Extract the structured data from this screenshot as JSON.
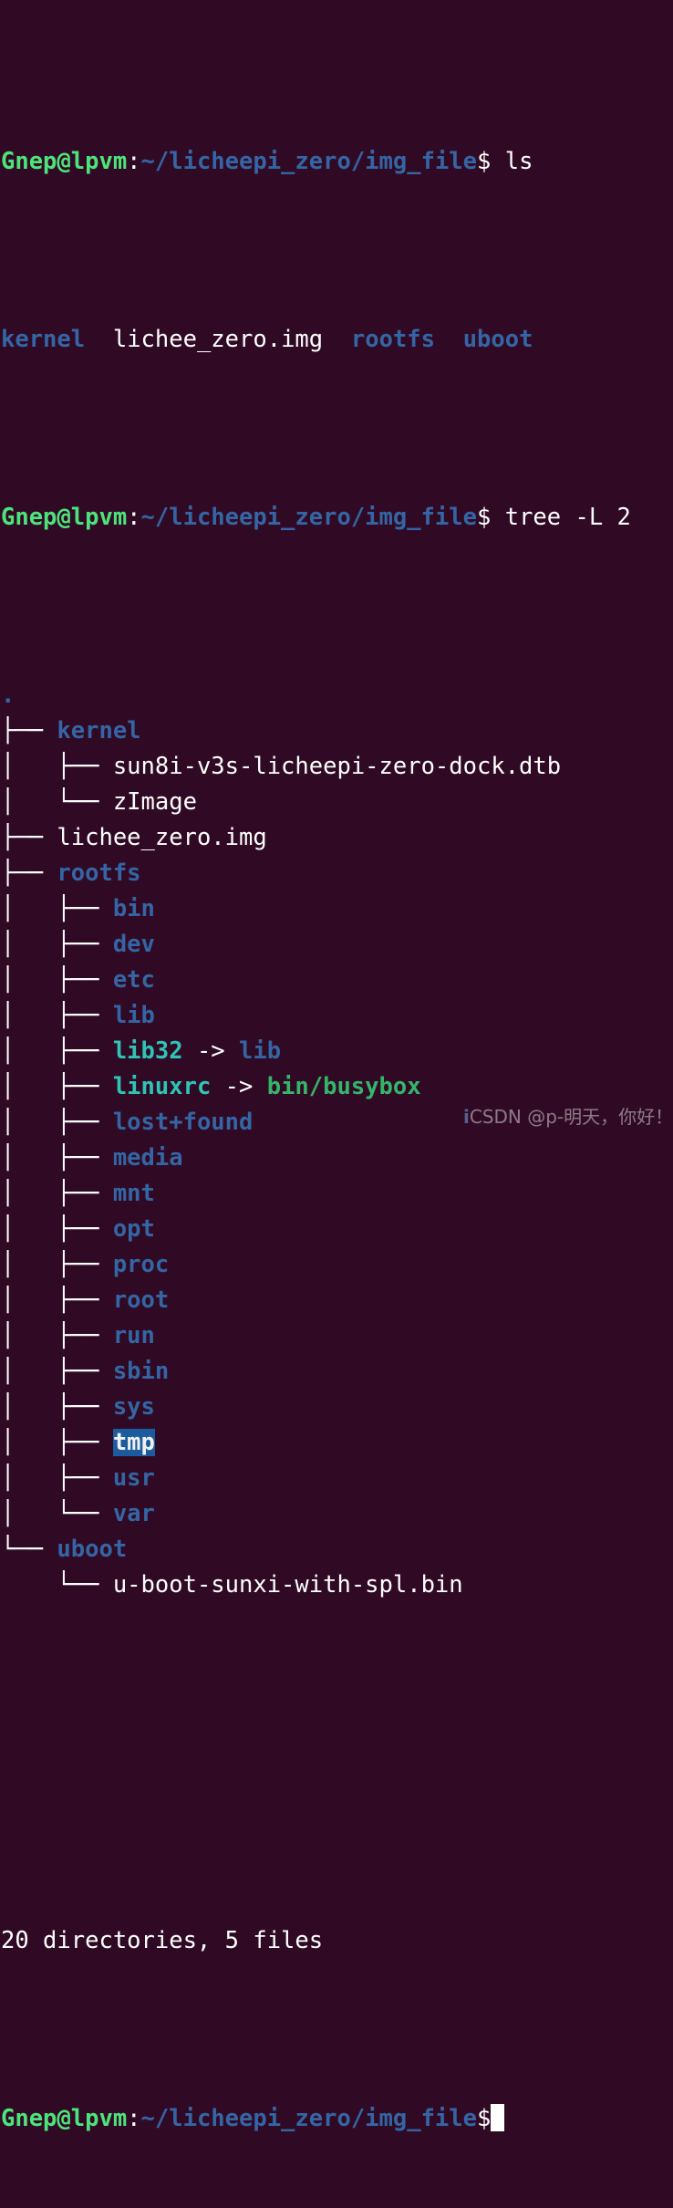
{
  "terminal": {
    "background_color": "#300a24",
    "foreground_color": "#ffffff",
    "prompt": {
      "user_host": "Gnep@lpvm",
      "separator": ":",
      "path": "~/licheepi_zero/img_file",
      "symbol": "$"
    },
    "commands": {
      "first": " ls",
      "second": " tree -L 2"
    },
    "ls_output": {
      "entries": [
        {
          "name": "kernel",
          "type": "dir"
        },
        {
          "name": "lichee_zero.img",
          "type": "file"
        },
        {
          "name": "rootfs",
          "type": "dir"
        },
        {
          "name": "uboot",
          "type": "dir"
        }
      ],
      "rendered": "kernel  lichee_zero.img  rootfs  uboot"
    },
    "tree_output": {
      "root": ".",
      "lines": [
        {
          "prefix": "",
          "name": ".",
          "type": "dir"
        },
        {
          "prefix": "├── ",
          "name": "kernel",
          "type": "dir"
        },
        {
          "prefix": "│   ├── ",
          "name": "sun8i-v3s-licheepi-zero-dock.dtb",
          "type": "file"
        },
        {
          "prefix": "│   └── ",
          "name": "zImage",
          "type": "file"
        },
        {
          "prefix": "├── ",
          "name": "lichee_zero.img",
          "type": "file"
        },
        {
          "prefix": "├── ",
          "name": "rootfs",
          "type": "dir"
        },
        {
          "prefix": "│   ├── ",
          "name": "bin",
          "type": "dir"
        },
        {
          "prefix": "│   ├── ",
          "name": "dev",
          "type": "dir"
        },
        {
          "prefix": "│   ├── ",
          "name": "etc",
          "type": "dir"
        },
        {
          "prefix": "│   ├── ",
          "name": "lib",
          "type": "dir"
        },
        {
          "prefix": "│   ├── ",
          "name": "lib32",
          "type": "link",
          "arrow": " -> ",
          "target": "lib",
          "target_type": "dir"
        },
        {
          "prefix": "│   ├── ",
          "name": "linuxrc",
          "type": "link",
          "arrow": " -> ",
          "target": "bin/busybox",
          "target_type": "exec"
        },
        {
          "prefix": "│   ├── ",
          "name": "lost+found",
          "type": "dir"
        },
        {
          "prefix": "│   ├── ",
          "name": "media",
          "type": "dir"
        },
        {
          "prefix": "│   ├── ",
          "name": "mnt",
          "type": "dir"
        },
        {
          "prefix": "│   ├── ",
          "name": "opt",
          "type": "dir"
        },
        {
          "prefix": "│   ├── ",
          "name": "proc",
          "type": "dir"
        },
        {
          "prefix": "│   ├── ",
          "name": "root",
          "type": "dir"
        },
        {
          "prefix": "│   ├── ",
          "name": "run",
          "type": "dir"
        },
        {
          "prefix": "│   ├── ",
          "name": "sbin",
          "type": "dir"
        },
        {
          "prefix": "│   ├── ",
          "name": "sys",
          "type": "dir"
        },
        {
          "prefix": "│   ├── ",
          "name": "tmp",
          "type": "dir",
          "selected": true
        },
        {
          "prefix": "│   ├── ",
          "name": "usr",
          "type": "dir"
        },
        {
          "prefix": "│   └── ",
          "name": "var",
          "type": "dir"
        },
        {
          "prefix": "└── ",
          "name": "uboot",
          "type": "dir"
        },
        {
          "prefix": "    └── ",
          "name": "u-boot-sunxi-with-spl.bin",
          "type": "file"
        }
      ],
      "summary": "20 directories, 5 files",
      "directory_count": 20,
      "file_count": 5
    },
    "selection": {
      "text": "tmp",
      "background_color": "#1c5c9e",
      "text_color": "#f0f0f0"
    },
    "cursor": {
      "style": "block",
      "color": "#ffffff"
    }
  },
  "watermark": {
    "logo": "i",
    "text": "CSDN @p-明天，你好！"
  }
}
